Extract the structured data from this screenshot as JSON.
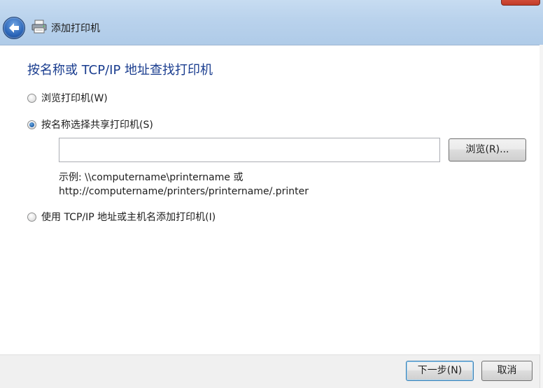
{
  "window": {
    "title": "添加打印机"
  },
  "page": {
    "heading": "按名称或 TCP/IP 地址查找打印机"
  },
  "options": [
    {
      "label": "浏览打印机(W)",
      "selected": false
    },
    {
      "label": "按名称选择共享打印机(S)",
      "selected": true
    },
    {
      "label": "使用 TCP/IP 地址或主机名添加打印机(I)",
      "selected": false
    }
  ],
  "share": {
    "value": "",
    "placeholder": "",
    "browse_label": "浏览(R)...",
    "example_line1": "示例: \\\\computername\\printername 或",
    "example_line2": "http://computername/printers/printername/.printer"
  },
  "footer": {
    "next_label": "下一步(N)",
    "cancel_label": "取消"
  },
  "icons": {
    "back": "back-arrow-icon",
    "printer": "printer-icon",
    "close": "close-icon"
  },
  "colors": {
    "heading": "#1a3d8f",
    "radio_selected": "#1f5fa8"
  }
}
